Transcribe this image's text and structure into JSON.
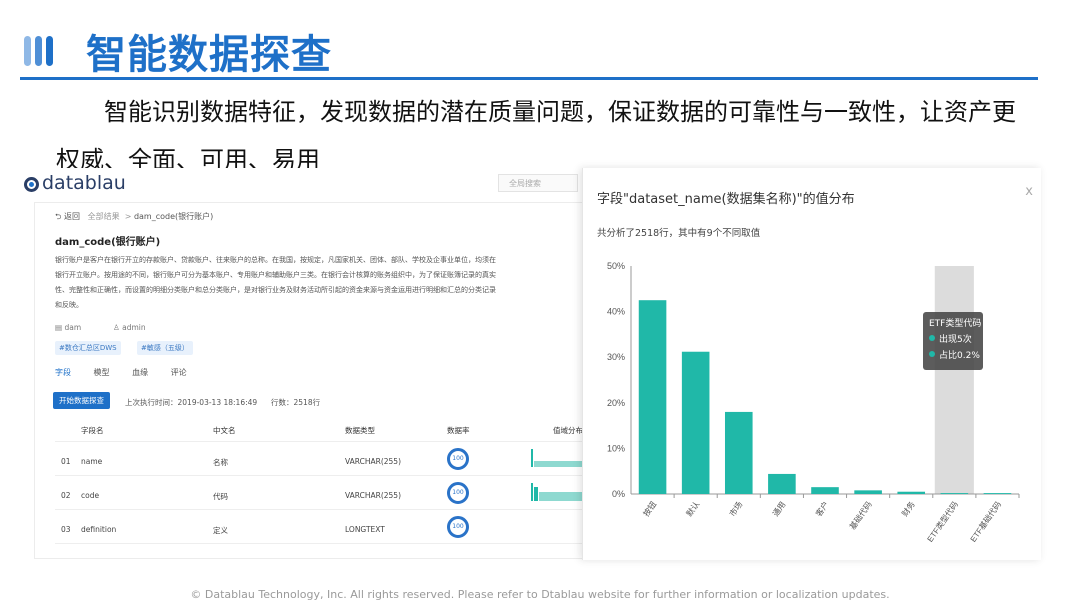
{
  "slide": {
    "title": "智能数据探查",
    "description": "智能识别数据特征，发现数据的潜在质量问题，保证数据的可靠性与一致性，让资产更权威、全面、可用、易用",
    "footer": "© Datablau Technology, Inc. All rights reserved.  Please refer to Dtablau website for further information or localization updates.",
    "colors": {
      "accent": "#1e70c8",
      "bar": "#20b8a8"
    }
  },
  "app": {
    "logo": "datablau",
    "search_placeholder": "全局搜索",
    "breadcrumb": {
      "back": "返回",
      "all": "全部结果",
      "current": "dam_code(银行账户)"
    },
    "asset_title": "dam_code(银行账户)",
    "asset_description": "银行账户是客户在银行开立的存款账户、贷款账户、往来账户的总称。在我国，按规定，凡国家机关、团体、部队、学校及企事业单位，均须在银行开立账户。按用途的不同，银行账户可分为基本账户、专用账户和辅助账户三类。在银行会计核算的账务组织中，为了保证账簿记录的真实性、完整性和正确性，而设置的明细分类账户和总分类账户，是对银行业务及财务活动所引起的资金来源与资金运用进行明细和汇总的分类记录和反映。",
    "owner_db": "dam",
    "owner_user": "admin",
    "tags": [
      "#数仓汇总区DWS",
      "#敏感（五级）"
    ],
    "tabs": [
      "字段",
      "模型",
      "血缘",
      "评论"
    ],
    "probe_button": "开始数据探查",
    "last_run_label": "上次执行时间：",
    "last_run": "2019-03-13 18:16:49",
    "rows_label": "行数：",
    "rows": "2518行",
    "columns": [
      "字段名",
      "中文名",
      "数据类型",
      "数据率",
      "值域分布"
    ],
    "rows_data": [
      {
        "no": "01",
        "field": "name",
        "cn": "名称",
        "type": "VARCHAR(255)",
        "rate": "100"
      },
      {
        "no": "02",
        "field": "code",
        "cn": "代码",
        "type": "VARCHAR(255)",
        "rate": "100"
      },
      {
        "no": "03",
        "field": "definition",
        "cn": "定义",
        "type": "LONGTEXT",
        "rate": "100"
      }
    ]
  },
  "panel": {
    "title": "字段\"dataset_name(数据集名称)\"的值分布",
    "close": "x",
    "summary": "共分析了2518行，其中有9个不同取值",
    "tooltip": {
      "title": "ETF类型代码",
      "count": "出现5次",
      "ratio": "占比0.2%"
    }
  },
  "chart_data": {
    "type": "bar",
    "categories": [
      "按钮",
      "默认",
      "市场",
      "通用",
      "客户",
      "基础代码",
      "财务",
      "ETF类型代码",
      "ETF基础代码"
    ],
    "values": [
      42.5,
      31.2,
      18.0,
      4.4,
      1.5,
      0.8,
      0.5,
      0.2,
      0.2
    ],
    "yticks": [
      "0%",
      "10%",
      "20%",
      "30%",
      "40%",
      "50%"
    ],
    "ylim": [
      0,
      50
    ],
    "highlight_index": 7
  }
}
